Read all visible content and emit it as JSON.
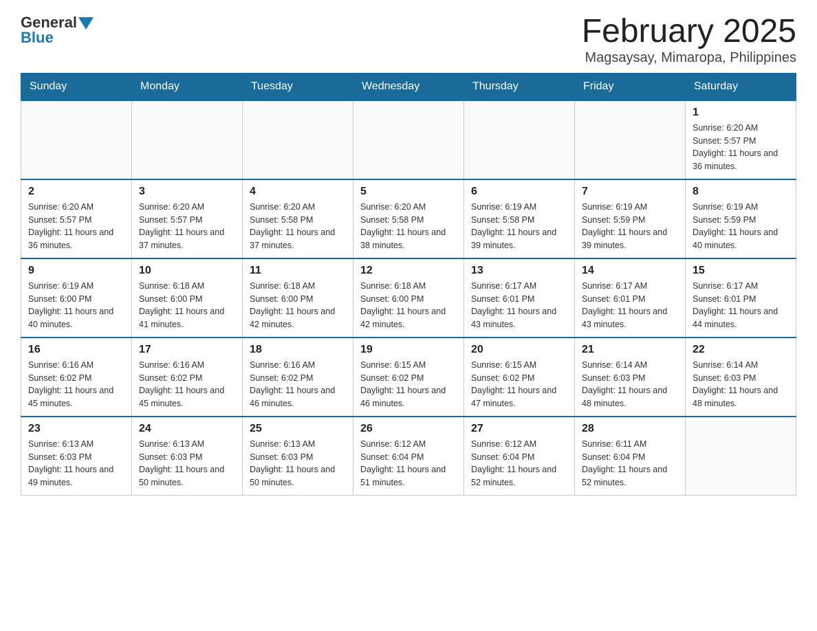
{
  "header": {
    "logo_general": "General",
    "logo_blue": "Blue",
    "title": "February 2025",
    "subtitle": "Magsaysay, Mimaropa, Philippines"
  },
  "days_of_week": [
    "Sunday",
    "Monday",
    "Tuesday",
    "Wednesday",
    "Thursday",
    "Friday",
    "Saturday"
  ],
  "weeks": [
    [
      {
        "day": "",
        "sunrise": "",
        "sunset": "",
        "daylight": "",
        "empty": true
      },
      {
        "day": "",
        "sunrise": "",
        "sunset": "",
        "daylight": "",
        "empty": true
      },
      {
        "day": "",
        "sunrise": "",
        "sunset": "",
        "daylight": "",
        "empty": true
      },
      {
        "day": "",
        "sunrise": "",
        "sunset": "",
        "daylight": "",
        "empty": true
      },
      {
        "day": "",
        "sunrise": "",
        "sunset": "",
        "daylight": "",
        "empty": true
      },
      {
        "day": "",
        "sunrise": "",
        "sunset": "",
        "daylight": "",
        "empty": true
      },
      {
        "day": "1",
        "sunrise": "Sunrise: 6:20 AM",
        "sunset": "Sunset: 5:57 PM",
        "daylight": "Daylight: 11 hours and 36 minutes.",
        "empty": false
      }
    ],
    [
      {
        "day": "2",
        "sunrise": "Sunrise: 6:20 AM",
        "sunset": "Sunset: 5:57 PM",
        "daylight": "Daylight: 11 hours and 36 minutes.",
        "empty": false
      },
      {
        "day": "3",
        "sunrise": "Sunrise: 6:20 AM",
        "sunset": "Sunset: 5:57 PM",
        "daylight": "Daylight: 11 hours and 37 minutes.",
        "empty": false
      },
      {
        "day": "4",
        "sunrise": "Sunrise: 6:20 AM",
        "sunset": "Sunset: 5:58 PM",
        "daylight": "Daylight: 11 hours and 37 minutes.",
        "empty": false
      },
      {
        "day": "5",
        "sunrise": "Sunrise: 6:20 AM",
        "sunset": "Sunset: 5:58 PM",
        "daylight": "Daylight: 11 hours and 38 minutes.",
        "empty": false
      },
      {
        "day": "6",
        "sunrise": "Sunrise: 6:19 AM",
        "sunset": "Sunset: 5:58 PM",
        "daylight": "Daylight: 11 hours and 39 minutes.",
        "empty": false
      },
      {
        "day": "7",
        "sunrise": "Sunrise: 6:19 AM",
        "sunset": "Sunset: 5:59 PM",
        "daylight": "Daylight: 11 hours and 39 minutes.",
        "empty": false
      },
      {
        "day": "8",
        "sunrise": "Sunrise: 6:19 AM",
        "sunset": "Sunset: 5:59 PM",
        "daylight": "Daylight: 11 hours and 40 minutes.",
        "empty": false
      }
    ],
    [
      {
        "day": "9",
        "sunrise": "Sunrise: 6:19 AM",
        "sunset": "Sunset: 6:00 PM",
        "daylight": "Daylight: 11 hours and 40 minutes.",
        "empty": false
      },
      {
        "day": "10",
        "sunrise": "Sunrise: 6:18 AM",
        "sunset": "Sunset: 6:00 PM",
        "daylight": "Daylight: 11 hours and 41 minutes.",
        "empty": false
      },
      {
        "day": "11",
        "sunrise": "Sunrise: 6:18 AM",
        "sunset": "Sunset: 6:00 PM",
        "daylight": "Daylight: 11 hours and 42 minutes.",
        "empty": false
      },
      {
        "day": "12",
        "sunrise": "Sunrise: 6:18 AM",
        "sunset": "Sunset: 6:00 PM",
        "daylight": "Daylight: 11 hours and 42 minutes.",
        "empty": false
      },
      {
        "day": "13",
        "sunrise": "Sunrise: 6:17 AM",
        "sunset": "Sunset: 6:01 PM",
        "daylight": "Daylight: 11 hours and 43 minutes.",
        "empty": false
      },
      {
        "day": "14",
        "sunrise": "Sunrise: 6:17 AM",
        "sunset": "Sunset: 6:01 PM",
        "daylight": "Daylight: 11 hours and 43 minutes.",
        "empty": false
      },
      {
        "day": "15",
        "sunrise": "Sunrise: 6:17 AM",
        "sunset": "Sunset: 6:01 PM",
        "daylight": "Daylight: 11 hours and 44 minutes.",
        "empty": false
      }
    ],
    [
      {
        "day": "16",
        "sunrise": "Sunrise: 6:16 AM",
        "sunset": "Sunset: 6:02 PM",
        "daylight": "Daylight: 11 hours and 45 minutes.",
        "empty": false
      },
      {
        "day": "17",
        "sunrise": "Sunrise: 6:16 AM",
        "sunset": "Sunset: 6:02 PM",
        "daylight": "Daylight: 11 hours and 45 minutes.",
        "empty": false
      },
      {
        "day": "18",
        "sunrise": "Sunrise: 6:16 AM",
        "sunset": "Sunset: 6:02 PM",
        "daylight": "Daylight: 11 hours and 46 minutes.",
        "empty": false
      },
      {
        "day": "19",
        "sunrise": "Sunrise: 6:15 AM",
        "sunset": "Sunset: 6:02 PM",
        "daylight": "Daylight: 11 hours and 46 minutes.",
        "empty": false
      },
      {
        "day": "20",
        "sunrise": "Sunrise: 6:15 AM",
        "sunset": "Sunset: 6:02 PM",
        "daylight": "Daylight: 11 hours and 47 minutes.",
        "empty": false
      },
      {
        "day": "21",
        "sunrise": "Sunrise: 6:14 AM",
        "sunset": "Sunset: 6:03 PM",
        "daylight": "Daylight: 11 hours and 48 minutes.",
        "empty": false
      },
      {
        "day": "22",
        "sunrise": "Sunrise: 6:14 AM",
        "sunset": "Sunset: 6:03 PM",
        "daylight": "Daylight: 11 hours and 48 minutes.",
        "empty": false
      }
    ],
    [
      {
        "day": "23",
        "sunrise": "Sunrise: 6:13 AM",
        "sunset": "Sunset: 6:03 PM",
        "daylight": "Daylight: 11 hours and 49 minutes.",
        "empty": false
      },
      {
        "day": "24",
        "sunrise": "Sunrise: 6:13 AM",
        "sunset": "Sunset: 6:03 PM",
        "daylight": "Daylight: 11 hours and 50 minutes.",
        "empty": false
      },
      {
        "day": "25",
        "sunrise": "Sunrise: 6:13 AM",
        "sunset": "Sunset: 6:03 PM",
        "daylight": "Daylight: 11 hours and 50 minutes.",
        "empty": false
      },
      {
        "day": "26",
        "sunrise": "Sunrise: 6:12 AM",
        "sunset": "Sunset: 6:04 PM",
        "daylight": "Daylight: 11 hours and 51 minutes.",
        "empty": false
      },
      {
        "day": "27",
        "sunrise": "Sunrise: 6:12 AM",
        "sunset": "Sunset: 6:04 PM",
        "daylight": "Daylight: 11 hours and 52 minutes.",
        "empty": false
      },
      {
        "day": "28",
        "sunrise": "Sunrise: 6:11 AM",
        "sunset": "Sunset: 6:04 PM",
        "daylight": "Daylight: 11 hours and 52 minutes.",
        "empty": false
      },
      {
        "day": "",
        "sunrise": "",
        "sunset": "",
        "daylight": "",
        "empty": true
      }
    ]
  ]
}
